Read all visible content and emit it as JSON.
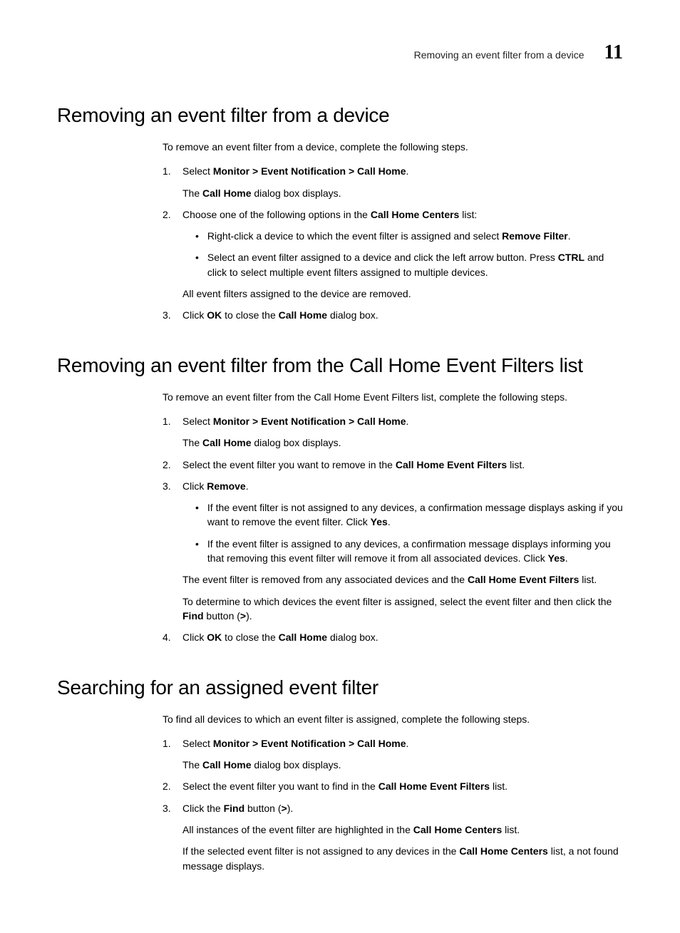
{
  "header": {
    "running_title": "Removing an event filter from a device",
    "chapter_number": "11"
  },
  "sections": [
    {
      "title": "Removing an event filter from a device",
      "intro": "To remove an event filter from a device, complete the following steps.",
      "steps": [
        {
          "num": "1.",
          "runs": [
            {
              "t": "Select "
            },
            {
              "t": "Monitor > Event Notification > Call Home",
              "b": true
            },
            {
              "t": "."
            }
          ],
          "after": [
            {
              "runs": [
                {
                  "t": "The "
                },
                {
                  "t": "Call Home",
                  "b": true
                },
                {
                  "t": " dialog box displays."
                }
              ]
            }
          ]
        },
        {
          "num": "2.",
          "runs": [
            {
              "t": "Choose one of the following options in the "
            },
            {
              "t": "Call Home Centers",
              "b": true
            },
            {
              "t": " list:"
            }
          ],
          "bullets": [
            {
              "runs": [
                {
                  "t": "Right-click a device to which the event filter is assigned and select "
                },
                {
                  "t": "Remove Filter",
                  "b": true
                },
                {
                  "t": "."
                }
              ]
            },
            {
              "runs": [
                {
                  "t": "Select an event filter assigned to a device and click the left arrow button. Press "
                },
                {
                  "t": "CTRL",
                  "b": true
                },
                {
                  "t": " and click to select multiple event filters assigned to multiple devices."
                }
              ]
            }
          ],
          "after": [
            {
              "runs": [
                {
                  "t": "All event filters assigned to the device are removed."
                }
              ]
            }
          ]
        },
        {
          "num": "3.",
          "runs": [
            {
              "t": "Click "
            },
            {
              "t": "OK",
              "b": true
            },
            {
              "t": " to close the "
            },
            {
              "t": "Call Home",
              "b": true
            },
            {
              "t": " dialog box."
            }
          ]
        }
      ]
    },
    {
      "title": "Removing an event filter from the Call Home Event Filters list",
      "intro": "To remove an event filter from the Call Home Event Filters list, complete the following steps.",
      "steps": [
        {
          "num": "1.",
          "runs": [
            {
              "t": "Select "
            },
            {
              "t": "Monitor > Event Notification > Call Home",
              "b": true
            },
            {
              "t": "."
            }
          ],
          "after": [
            {
              "runs": [
                {
                  "t": "The "
                },
                {
                  "t": "Call Home",
                  "b": true
                },
                {
                  "t": " dialog box displays."
                }
              ]
            }
          ]
        },
        {
          "num": "2.",
          "runs": [
            {
              "t": "Select the event filter you want to remove in the "
            },
            {
              "t": "Call Home Event Filters",
              "b": true
            },
            {
              "t": " list."
            }
          ]
        },
        {
          "num": "3.",
          "runs": [
            {
              "t": "Click "
            },
            {
              "t": "Remove",
              "b": true
            },
            {
              "t": "."
            }
          ],
          "bullets": [
            {
              "runs": [
                {
                  "t": "If the event filter is not assigned to any devices, a confirmation message displays asking if you want to remove the event filter. Click "
                },
                {
                  "t": "Yes",
                  "b": true
                },
                {
                  "t": "."
                }
              ]
            },
            {
              "runs": [
                {
                  "t": "If the event filter is assigned to any devices, a confirmation message displays informing you that removing this event filter will remove it from all associated devices. Click "
                },
                {
                  "t": "Yes",
                  "b": true
                },
                {
                  "t": "."
                }
              ]
            }
          ],
          "after": [
            {
              "runs": [
                {
                  "t": "The event filter is removed from any associated devices and the "
                },
                {
                  "t": "Call Home Event Filters",
                  "b": true
                },
                {
                  "t": " list."
                }
              ]
            },
            {
              "runs": [
                {
                  "t": "To determine to which devices the event filter is assigned, select the event filter and then click the "
                },
                {
                  "t": "Find",
                  "b": true
                },
                {
                  "t": " button ("
                },
                {
                  "t": ">",
                  "b": true
                },
                {
                  "t": ")."
                }
              ]
            }
          ]
        },
        {
          "num": "4.",
          "runs": [
            {
              "t": "Click "
            },
            {
              "t": "OK",
              "b": true
            },
            {
              "t": " to close the "
            },
            {
              "t": "Call Home",
              "b": true
            },
            {
              "t": " dialog box."
            }
          ]
        }
      ]
    },
    {
      "title": "Searching for an assigned event filter",
      "intro": "To find all devices to which an event filter is assigned, complete the following steps.",
      "steps": [
        {
          "num": "1.",
          "runs": [
            {
              "t": "Select "
            },
            {
              "t": "Monitor > Event Notification > Call Home",
              "b": true
            },
            {
              "t": "."
            }
          ],
          "after": [
            {
              "runs": [
                {
                  "t": "The "
                },
                {
                  "t": "Call Home",
                  "b": true
                },
                {
                  "t": " dialog box displays."
                }
              ]
            }
          ]
        },
        {
          "num": "2.",
          "runs": [
            {
              "t": "Select the event filter you want to find in the "
            },
            {
              "t": "Call Home Event Filters",
              "b": true
            },
            {
              "t": " list."
            }
          ]
        },
        {
          "num": "3.",
          "runs": [
            {
              "t": "Click the "
            },
            {
              "t": "Find",
              "b": true
            },
            {
              "t": " button ("
            },
            {
              "t": ">",
              "b": true
            },
            {
              "t": ")."
            }
          ],
          "after": [
            {
              "runs": [
                {
                  "t": "All instances of the event filter are highlighted in the "
                },
                {
                  "t": "Call Home Centers",
                  "b": true
                },
                {
                  "t": " list."
                }
              ]
            },
            {
              "runs": [
                {
                  "t": "If the selected event filter is not assigned to any devices in the "
                },
                {
                  "t": "Call Home Centers",
                  "b": true
                },
                {
                  "t": " list, a not found message displays."
                }
              ]
            }
          ]
        }
      ]
    }
  ]
}
